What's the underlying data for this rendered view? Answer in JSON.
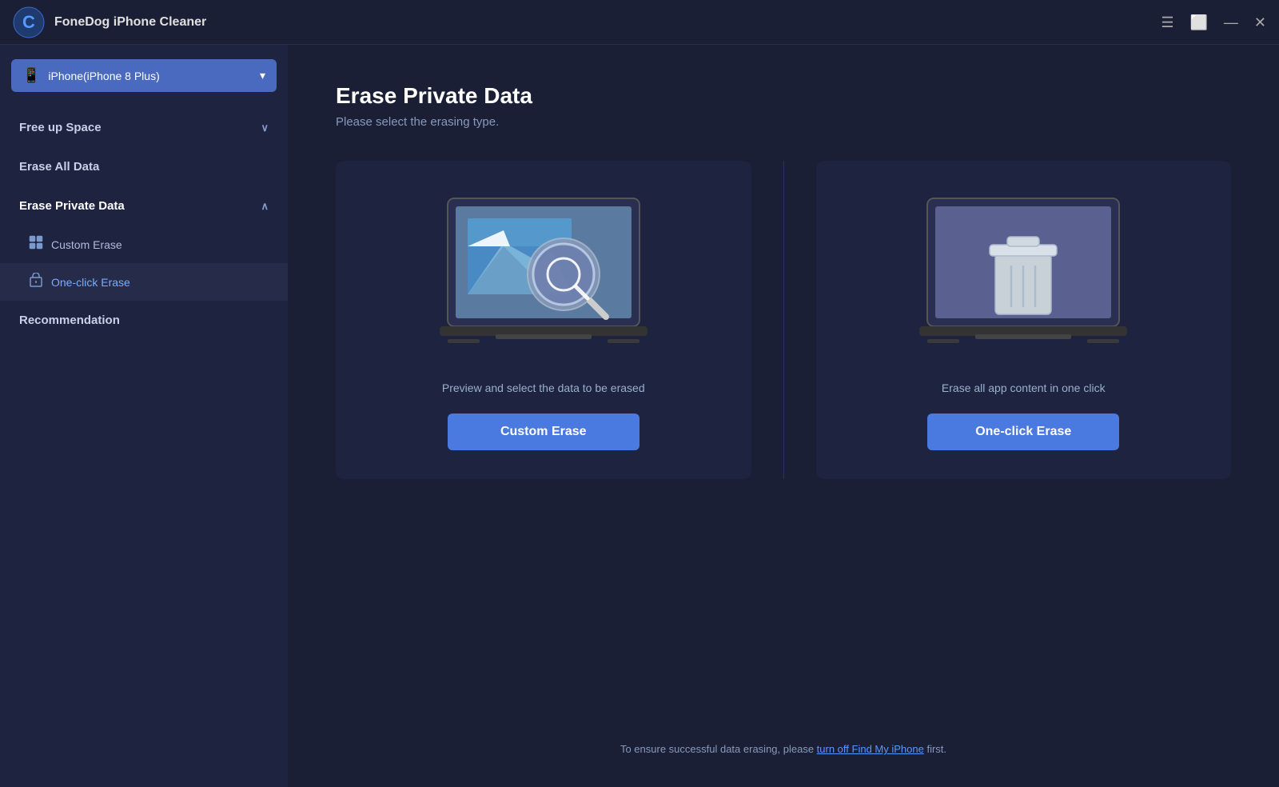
{
  "app": {
    "name": "FoneDog iPhone Cleaner",
    "logo_letter": "C"
  },
  "titlebar": {
    "controls": {
      "menu_label": "☰",
      "comment_label": "⬜",
      "minimize_label": "—",
      "close_label": "✕"
    }
  },
  "device": {
    "label": "iPhone(iPhone 8 Plus)",
    "chevron": "▾"
  },
  "sidebar": {
    "items": [
      {
        "id": "free-up-space",
        "label": "Free up Space",
        "has_chevron": true,
        "chevron": "∨",
        "expanded": false
      },
      {
        "id": "erase-all-data",
        "label": "Erase All Data",
        "has_chevron": false
      },
      {
        "id": "erase-private-data",
        "label": "Erase Private Data",
        "has_chevron": true,
        "chevron": "∧",
        "expanded": true
      },
      {
        "id": "recommendation",
        "label": "Recommendation",
        "has_chevron": false
      }
    ],
    "sub_items": [
      {
        "id": "custom-erase",
        "label": "Custom Erase",
        "icon": "⊞"
      },
      {
        "id": "one-click-erase",
        "label": "One-click Erase",
        "icon": "🗑"
      }
    ]
  },
  "content": {
    "page_title": "Erase Private Data",
    "page_subtitle": "Please select the erasing type.",
    "cards": [
      {
        "id": "custom-erase-card",
        "description": "Preview and select the data to be erased",
        "button_label": "Custom Erase"
      },
      {
        "id": "one-click-erase-card",
        "description": "Erase all app content in one click",
        "button_label": "One-click Erase"
      }
    ],
    "footer_note_before_link": "To ensure successful data erasing, please ",
    "footer_link_text": "turn off Find My iPhone",
    "footer_note_after_link": " first."
  },
  "colors": {
    "accent": "#4a7ae0",
    "sidebar_bg": "#1e2340",
    "content_bg": "#1a1f35",
    "card_bg": "#252b4a"
  }
}
